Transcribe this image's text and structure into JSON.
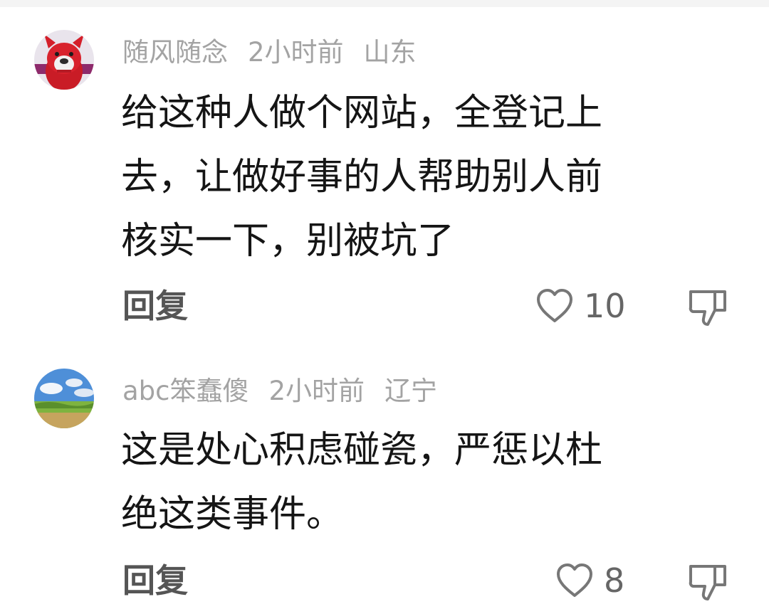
{
  "comments": [
    {
      "username": "随风随念",
      "time": "2小时前",
      "location": "山东",
      "lines": [
        "给这种人做个网站，全登记上",
        "去，让做好事的人帮助别人前",
        "核实一下，别被坑了"
      ],
      "reply_label": "回复",
      "likes": "10",
      "avatar_icon": "bulldog-avatar",
      "like_icon": "heart-icon",
      "dislike_icon": "thumbs-down-icon"
    },
    {
      "username": "abc笨蠢傻",
      "time": "2小时前",
      "location": "辽宁",
      "lines": [
        "这是处心积虑碰瓷，严惩以杜",
        "绝这类事件。"
      ],
      "reply_label": "回复",
      "likes": "8",
      "avatar_icon": "landscape-avatar",
      "like_icon": "heart-icon",
      "dislike_icon": "thumbs-down-icon"
    }
  ],
  "colors": {
    "meta_text": "#a3a3a3",
    "body_text": "#151515",
    "reply_text": "#555555",
    "icon_gray": "#777777"
  }
}
